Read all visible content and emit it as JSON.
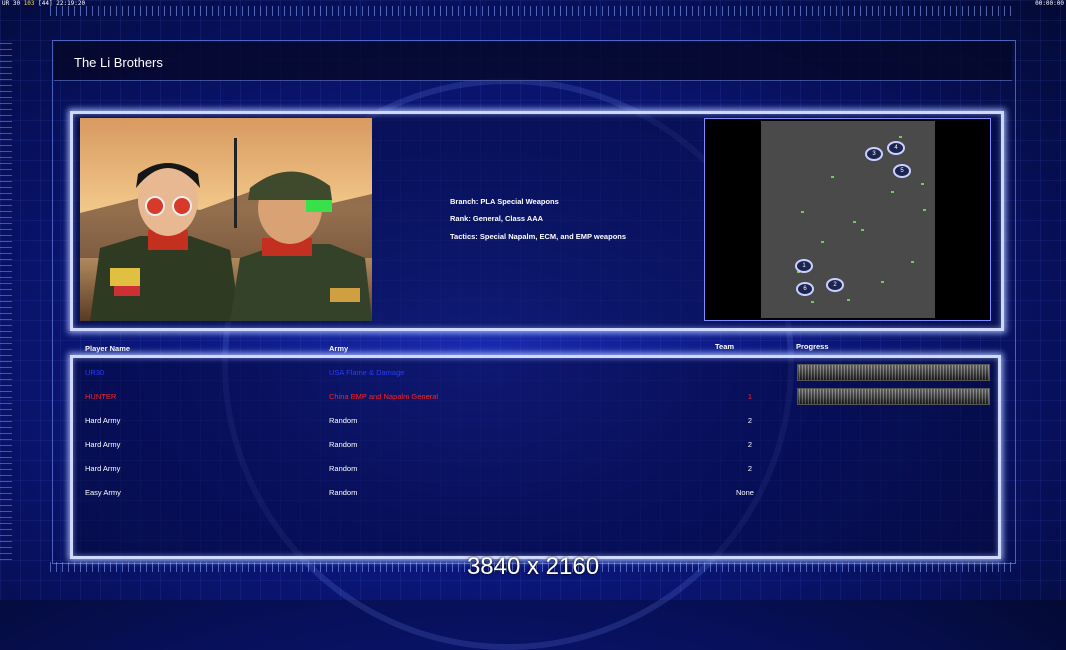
{
  "hud": {
    "top_left_prefix": "UR 30",
    "top_left_fps": "103",
    "top_left_mid": "[44]",
    "top_left_time": "22:19:20",
    "top_right_time": "00:00:00"
  },
  "title": "The Li Brothers",
  "general": {
    "branch": "Branch: PLA Special Weapons",
    "rank": "Rank: General, Class AAA",
    "tactics": "Tactics: Special Napalm, ECM, and EMP weapons"
  },
  "map": {
    "start_positions": [
      "1",
      "2",
      "3",
      "4",
      "5",
      "6"
    ]
  },
  "table": {
    "headers": {
      "name": "Player Name",
      "army": "Army",
      "team": "Team",
      "progress": "Progress"
    },
    "rows": [
      {
        "name": "UR30",
        "army": "USA Flame & Damage",
        "team": "",
        "color": "#2a3cff",
        "progress": 1.0
      },
      {
        "name": "HUNTER",
        "army": "China EMP and Napalm General",
        "team": "1",
        "color": "#ff2020",
        "progress": 1.0
      },
      {
        "name": "Hard Army",
        "army": "Random",
        "team": "2",
        "color": "#ffffff"
      },
      {
        "name": "Hard Army",
        "army": "Random",
        "team": "2",
        "color": "#ffffff"
      },
      {
        "name": "Hard Army",
        "army": "Random",
        "team": "2",
        "color": "#ffffff"
      },
      {
        "name": "Easy Army",
        "army": "Random",
        "team": "None",
        "color": "#ffffff"
      }
    ]
  },
  "overlay_text": "3840 x 2160",
  "colors": {
    "background": "#0c1880",
    "panel_border": "#cfd8ff",
    "player_blue": "#2a3cff",
    "player_red": "#ff2020"
  }
}
